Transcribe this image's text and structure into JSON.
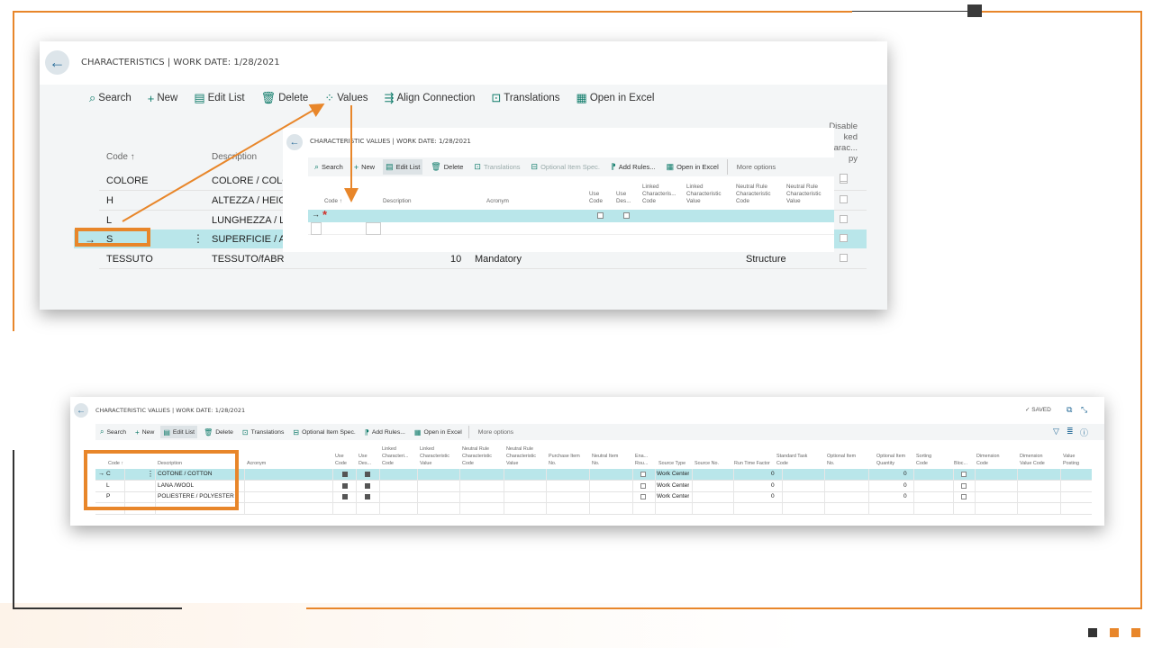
{
  "colors": {
    "accent": "#e8862a",
    "teal": "#107c6b",
    "selected": "#b9e6ea"
  },
  "main_window": {
    "title": "CHARACTERISTICS | WORK DATE: 1/28/2021",
    "actions": [
      {
        "label": "Search",
        "icon": "search-icon"
      },
      {
        "label": "New",
        "icon": "plus-icon"
      },
      {
        "label": "Edit List",
        "icon": "edit-list-icon"
      },
      {
        "label": "Delete",
        "icon": "trash-icon"
      },
      {
        "label": "Values",
        "icon": "values-icon"
      },
      {
        "label": "Align Connection",
        "icon": "align-icon"
      },
      {
        "label": "Translations",
        "icon": "translations-icon"
      },
      {
        "label": "Open in Excel",
        "icon": "excel-icon"
      }
    ],
    "columns": {
      "code": "Code ↑",
      "description": "Description",
      "disable": [
        "Disable",
        "ked",
        "arac...",
        "py"
      ]
    },
    "rows": [
      {
        "code": "COLORE",
        "description": "COLORE / COLO"
      },
      {
        "code": "H",
        "description": "ALTEZZA / HEIGH"
      },
      {
        "code": "L",
        "description": "LUNGHEZZA / LE"
      },
      {
        "code": "S",
        "description": "SUPERFICIE / AR",
        "selected": true
      },
      {
        "code": "TESSUTO",
        "description": "TESSUTO/fABRIC",
        "num": "10",
        "type": "Mandatory",
        "kind": "Structure"
      }
    ]
  },
  "popup_window": {
    "title": "CHARACTERISTIC VALUES | WORK DATE: 1/28/2021",
    "actions": [
      {
        "label": "Search",
        "icon": "search-icon"
      },
      {
        "label": "New",
        "icon": "plus-icon"
      },
      {
        "label": "Edit List",
        "icon": "edit-list-icon"
      },
      {
        "label": "Delete",
        "icon": "trash-icon"
      },
      {
        "label": "Translations",
        "icon": "translations-icon"
      },
      {
        "label": "Optional Item Spec.",
        "icon": "optional-spec-icon"
      },
      {
        "label": "Add Rules...",
        "icon": "add-rules-icon"
      },
      {
        "label": "Open in Excel",
        "icon": "excel-icon"
      },
      {
        "label": "More options",
        "icon": ""
      }
    ],
    "columns": [
      [
        "Code ↑"
      ],
      [
        "Description"
      ],
      [
        "Acronym"
      ],
      [
        "Use",
        "Code"
      ],
      [
        "Use",
        "Des..."
      ],
      [
        "Linked",
        "Characteris...",
        "Code"
      ],
      [
        "Linked",
        "Characteristic",
        "Value"
      ],
      [
        "Neutral Rule",
        "Characteristic",
        "Code"
      ],
      [
        "Neutral Rule",
        "Characteristic",
        "Value"
      ]
    ],
    "new_row_marker": "*"
  },
  "bottom_window": {
    "title": "CHARACTERISTIC VALUES | WORK DATE: 1/28/2021",
    "status": "SAVED",
    "actions": [
      {
        "label": "Search",
        "icon": "search-icon"
      },
      {
        "label": "New",
        "icon": "plus-icon"
      },
      {
        "label": "Edit List",
        "icon": "edit-list-icon"
      },
      {
        "label": "Delete",
        "icon": "trash-icon"
      },
      {
        "label": "Translations",
        "icon": "translations-icon"
      },
      {
        "label": "Optional Item Spec.",
        "icon": "optional-spec-icon"
      },
      {
        "label": "Add Rules...",
        "icon": "add-rules-icon"
      },
      {
        "label": "Open in Excel",
        "icon": "excel-icon"
      },
      {
        "label": "More options",
        "icon": ""
      }
    ],
    "columns": [
      [
        "Code ↑"
      ],
      [
        "Description"
      ],
      [
        "Acronym"
      ],
      [
        "Use",
        "Code"
      ],
      [
        "Use",
        "Des..."
      ],
      [
        "Linked",
        "Characteri...",
        "Code"
      ],
      [
        "Linked",
        "Characteristic",
        "Value"
      ],
      [
        "Neutral Rule",
        "Characteristic",
        "Code"
      ],
      [
        "Neutral Rule",
        "Characteristic",
        "Value"
      ],
      [
        "Purchase Item",
        "No."
      ],
      [
        "Neutral Item",
        "No."
      ],
      [
        "Ena...",
        "Rou..."
      ],
      [
        "Source Type"
      ],
      [
        "Source No."
      ],
      [
        "Run Time Factor"
      ],
      [
        "Standard Task",
        "Code"
      ],
      [
        "Optional Item",
        "No."
      ],
      [
        "Optional Item",
        "Quantity"
      ],
      [
        "Sorting",
        "Code"
      ],
      [
        "Bloc..."
      ],
      [
        "Dimension",
        "Code"
      ],
      [
        "Dimension",
        "Value Code"
      ],
      [
        "Value",
        "Posting"
      ]
    ],
    "rows": [
      {
        "code": "C",
        "description": "COTONE / COTTON",
        "source_type": "Work Center",
        "run_time": "0",
        "opt_qty": "0",
        "selected": true
      },
      {
        "code": "L",
        "description": "LANA /WOOL",
        "source_type": "Work Center",
        "run_time": "0",
        "opt_qty": "0"
      },
      {
        "code": "P",
        "description": "POLIESTERE / POLYESTER",
        "source_type": "Work Center",
        "run_time": "0",
        "opt_qty": "0"
      }
    ]
  }
}
